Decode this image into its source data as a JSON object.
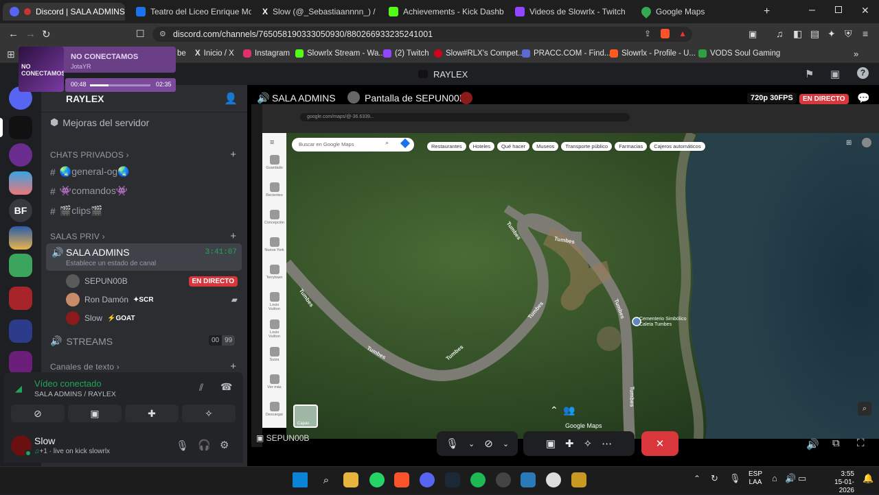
{
  "browser": {
    "tabs": [
      {
        "title": "Discord | SALA ADMINS |",
        "color": "#5865f2",
        "active": true
      },
      {
        "title": "Teatro del Liceo Enrique Molina",
        "color": "#1a73e8"
      },
      {
        "title": "Slow (@_Sebastiaannnn_) / X",
        "color": "#000000"
      },
      {
        "title": "Achievements - Kick Dashboard",
        "color": "#53fc18"
      },
      {
        "title": "Videos de Slowrlx - Twitch",
        "color": "#9146ff"
      },
      {
        "title": "Google Maps",
        "color": "#34a853"
      }
    ],
    "url": "discord.com/channels/765058190333050930/880266933235241001",
    "bookmarks": [
      {
        "label": "Inicio / X",
        "color": "#000000"
      },
      {
        "label": "Instagram",
        "color": "#e1306c"
      },
      {
        "label": "Slowrlx Stream - Wa...",
        "color": "#53fc18"
      },
      {
        "label": "(2) Twitch",
        "color": "#9146ff"
      },
      {
        "label": "Slow#RLX's Compet...",
        "color": "#d0021b"
      },
      {
        "label": "PRACC.COM - Find...",
        "color": "#5b6ad0"
      },
      {
        "label": "Slowrlx - Profile - U...",
        "color": "#ff5a1f"
      },
      {
        "label": "VODS Soul Gaming",
        "color": "#2ea043"
      }
    ],
    "partial_bookmark": "be"
  },
  "mini_player": {
    "title": "NO CONECTAMOS",
    "artist": "JotaYR",
    "elapsed": "00:48",
    "total": "02:35",
    "progress": 0.31,
    "cover_text": "NO CONECTAMOS"
  },
  "discord": {
    "server_title": "RAYLEX",
    "server_name": "RAYLEX",
    "guild_bf": "BF",
    "boost_label": "Mejoras del servidor",
    "categories": {
      "private_chats": "CHATS PRIVADOS",
      "private_rooms": "SALAS PRIV",
      "text_channels": "Canales de texto"
    },
    "text_channels": [
      {
        "label": "🌏general-og🌏"
      },
      {
        "label": "👾comandos👾"
      },
      {
        "label": "🎬clips🎬"
      }
    ],
    "voice_channel": {
      "name": "SALA ADMINS",
      "timer": "3:41:07",
      "status": "Establece un estado de canal"
    },
    "members": [
      {
        "name": "SEPUN00B",
        "badge": "EN DIRECTO",
        "avatar": "#5a5a5a"
      },
      {
        "name": "Ron Damón",
        "tag": "SCR",
        "avatar": "#c98c6b"
      },
      {
        "name": "Slow",
        "tag": "GOAT",
        "avatar": "#8b1a1a"
      }
    ],
    "streams": {
      "name": "STREAMS",
      "count_a": "00",
      "count_b": "99"
    },
    "voice_panel": {
      "status": "Vídeo conectado",
      "location": "SALA ADMINS / RAYLEX"
    },
    "user": {
      "name": "Slow",
      "status": "live on kick slowrlx",
      "plus": "+1"
    }
  },
  "stream": {
    "channel": "SALA ADMINS",
    "screen_title": "Pantalla de SEPUN00B",
    "quality": "720p 30FPS",
    "live_badge": "EN DIRECTO",
    "streamer_label": "SEPUN00B"
  },
  "maps": {
    "url": "google.com/maps/@-36.6339...",
    "search_placeholder": "Buscar en Google Maps",
    "chips": [
      "Restaurantes",
      "Hoteles",
      "Qué hacer",
      "Museos",
      "Transporte público",
      "Farmacias",
      "Cajeros automáticos"
    ],
    "sidebar": [
      "Guardado",
      "Recientes",
      "Concepción",
      "Nueva York",
      "Terrytown",
      "Louis Vuitton",
      "Louis Vuitton",
      "Suiza",
      "Ver más",
      "Descargar"
    ],
    "roads": [
      "Tumbes",
      "Tumbes",
      "Tumbes",
      "Tumbes",
      "Tumbes",
      "Tumbes",
      "Tumbes",
      "Tumbes"
    ],
    "place": "Cementerio Simbólico Caleta Tumbes",
    "layer_label": "Capas",
    "brand": "Google Maps"
  },
  "taskbar": {
    "lang": "ESP",
    "layout": "LAA",
    "time": "3:55",
    "date": "15-01-2026"
  }
}
